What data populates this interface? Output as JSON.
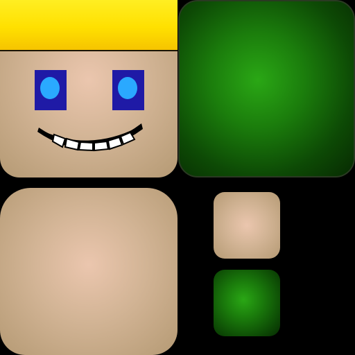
{
  "texture_atlas": {
    "background_color": "#000000",
    "tiles": [
      {
        "id": "face",
        "color": "#d2b495",
        "features": [
          "yellow-hair",
          "blue-eyes",
          "grin"
        ]
      },
      {
        "id": "green-large",
        "color": "#1b7d0c"
      },
      {
        "id": "skin-large",
        "color": "#d2b495"
      },
      {
        "id": "skin-small",
        "color": "#d2b495"
      },
      {
        "id": "green-small",
        "color": "#1b7d0c"
      }
    ],
    "colors": {
      "hair": "#ffe000",
      "eye_outer": "#1f1aa6",
      "eye_inner": "#2aa9ff",
      "skin": "#d2b495",
      "green": "#1b7d0c",
      "teeth": "#ffffff",
      "mouth_outline": "#000000"
    }
  }
}
